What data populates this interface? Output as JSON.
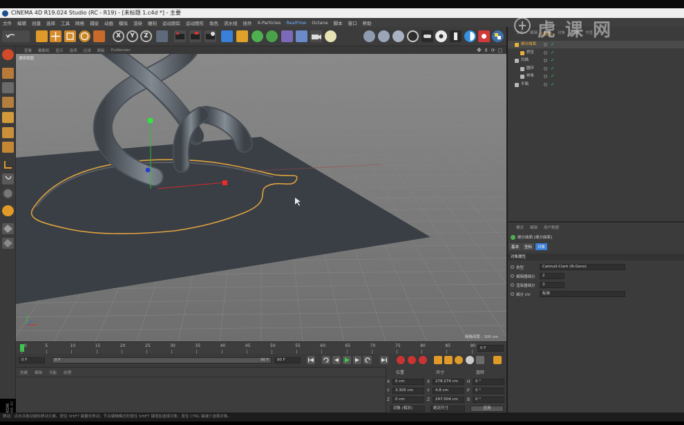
{
  "window": {
    "title": "CINEMA 4D R19.024 Studio (RC - R19) - [未标题 1.c4d *] - 主要"
  },
  "menubar": {
    "items": [
      "文件",
      "编辑",
      "创建",
      "选择",
      "工具",
      "网格",
      "捕捉",
      "动画",
      "模拟",
      "渲染",
      "雕刻",
      "运动跟踪",
      "运动图形",
      "角色",
      "流水线",
      "插件",
      "X-Particles",
      "RealFlow",
      "Octane",
      "脚本",
      "窗口",
      "帮助"
    ],
    "highlight_index": 17
  },
  "toolbar": {
    "undo_icon": "undo-icon",
    "axis_buttons": [
      "X",
      "Y",
      "Z"
    ],
    "colors": {
      "accent_orange": "#e09a2a",
      "accent_blue": "#3a7fd8"
    }
  },
  "viewport": {
    "menu": [
      "查看",
      "摄像机",
      "显示",
      "选项",
      "过滤",
      "面板",
      "ProRender"
    ],
    "label": "透视视图",
    "grid_spacing": "网格间距 : 100 cm"
  },
  "timeline": {
    "ticks": [
      "0",
      "5",
      "10",
      "15",
      "20",
      "25",
      "30",
      "35",
      "40",
      "45",
      "50",
      "55",
      "60",
      "65",
      "70",
      "75",
      "80",
      "85",
      "90"
    ],
    "end_frame": "0 F",
    "start_field": "0 F",
    "slider_start": "0 F",
    "slider_end": "90 F",
    "end_field": "90 F"
  },
  "bottom_panel": {
    "menu": [
      "创建",
      "编辑",
      "功能",
      "纹理"
    ]
  },
  "coordinates": {
    "headers": [
      "位置",
      "尺寸",
      "旋转"
    ],
    "rows": [
      {
        "axis": "X",
        "pos": "0 cm",
        "size_axis": "X",
        "size": "278.274 cm",
        "rot_axis": "H",
        "rot": "0 °"
      },
      {
        "axis": "Y",
        "pos": "3.305 cm",
        "size_axis": "Y",
        "size": "4.8 cm",
        "rot_axis": "P",
        "rot": "0 °"
      },
      {
        "axis": "Z",
        "pos": "0 cm",
        "size_axis": "Z",
        "size": "247.504 cm",
        "rot_axis": "B",
        "rot": "0 °"
      }
    ],
    "mode_select": "对象 (相对)",
    "size_select": "绝对尺寸",
    "apply_button": "应用"
  },
  "object_manager": {
    "menu": [
      "文件",
      "编辑",
      "查看",
      "对象",
      "标签",
      "书签"
    ],
    "objects": [
      {
        "name": "细分曲面",
        "indent": 0,
        "color": "#e7b23a",
        "selected": true
      },
      {
        "name": "挤压",
        "indent": 1,
        "color": "#e7b23a",
        "selected": false
      },
      {
        "name": "扫描",
        "indent": 0,
        "color": "#b8b8b8",
        "selected": false
      },
      {
        "name": "圆环",
        "indent": 1,
        "color": "#b8b8b8",
        "selected": false
      },
      {
        "name": "样条",
        "indent": 1,
        "color": "#b8b8b8",
        "selected": false
      },
      {
        "name": "平面",
        "indent": 0,
        "color": "#b8b8b8",
        "selected": false
      }
    ]
  },
  "attribute_manager": {
    "menu": [
      "模式",
      "编辑",
      "用户数据"
    ],
    "object_title": "细分曲面 [细分曲面]",
    "tabs": [
      "基本",
      "坐标",
      "对象"
    ],
    "active_tab_index": 2,
    "section_title": "对象属性",
    "fields": [
      {
        "label": "类型",
        "value": "Catmull-Clark (N-Gons)"
      },
      {
        "label": "编辑器细分",
        "value": "2"
      },
      {
        "label": "渲染器细分",
        "value": "3"
      },
      {
        "label": "细分 UV",
        "value": "标准"
      }
    ]
  },
  "sidebar_brand": {
    "maxon": "MAXON",
    "cinema": "CINEMA 4D"
  },
  "statusbar": {
    "text": "移动：点击并拖动鼠标移动元素。按住 SHIFT 键量化移动；节点编辑模式时按住 SHIFT 键增加选择对象；按住 CTRL 键减少选择对象。"
  },
  "watermark": {
    "text": "虎课网"
  }
}
